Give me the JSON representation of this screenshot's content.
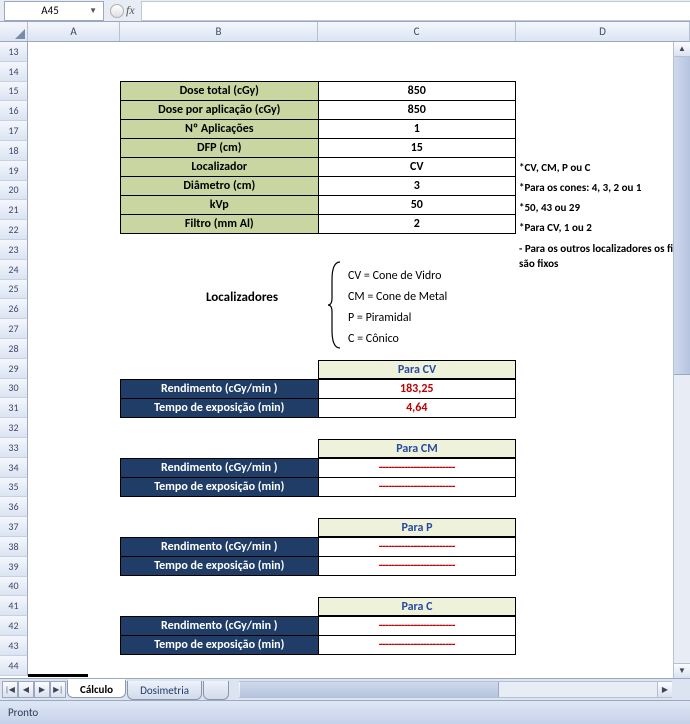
{
  "namebox": "A45",
  "fx": "fx",
  "columns": [
    "A",
    "B",
    "C",
    "D"
  ],
  "row_start": 13,
  "row_end": 44,
  "params": [
    {
      "label": "Dose total (cGy)",
      "value": "850"
    },
    {
      "label": "Dose por aplicação (cGy)",
      "value": "850"
    },
    {
      "label": "Nº Aplicações",
      "value": "1"
    },
    {
      "label": "DFP (cm)",
      "value": "15"
    },
    {
      "label": "Localizador",
      "value": "CV"
    },
    {
      "label": "Diâmetro (cm)",
      "value": "3"
    },
    {
      "label": "kVp",
      "value": "50"
    },
    {
      "label": "Filtro (mm Al)",
      "value": "2"
    }
  ],
  "notes": {
    "r19": "*CV, CM, P ou C",
    "r20": "*Para os cones: 4, 3, 2 ou 1",
    "r21": "*50, 43 ou 29",
    "r22": "*Para CV, 1 ou 2",
    "r23": " - Para os outros localizadores os filtros são fixos"
  },
  "loc_title": "Localizadores",
  "loc_list": [
    "CV = Cone de Vidro",
    "CM = Cone de Metal",
    "P = Piramidal",
    "C = Cônico"
  ],
  "results": [
    {
      "header": "Para CV",
      "rend": "183,25",
      "tempo": "4,64",
      "dash": false
    },
    {
      "header": "Para CM",
      "rend": "------------------------",
      "tempo": "------------------------",
      "dash": true
    },
    {
      "header": "Para P",
      "rend": "------------------------",
      "tempo": "------------------------",
      "dash": true
    },
    {
      "header": "Para C",
      "rend": "------------------------",
      "tempo": "------------------------",
      "dash": true
    }
  ],
  "result_labels": {
    "rend": "Rendimento (cGy/min )",
    "tempo": "Tempo de exposição (min)"
  },
  "tabs": {
    "active": "Cálculo",
    "other": "Dosimetria"
  },
  "status": "Pronto"
}
